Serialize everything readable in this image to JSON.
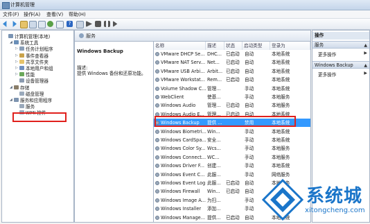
{
  "window": {
    "title": "计算机管理"
  },
  "menu": [
    "文件(F)",
    "操作(A)",
    "查看(V)",
    "帮助(H)"
  ],
  "tree": [
    {
      "label": "计算机管理(本地)",
      "level": 0,
      "exp": ""
    },
    {
      "label": "系统工具",
      "level": 1,
      "exp": "◢"
    },
    {
      "label": "任务计划程序",
      "level": 2,
      "exp": "▷"
    },
    {
      "label": "事件查看器",
      "level": 2,
      "exp": "▷"
    },
    {
      "label": "共享文件夹",
      "level": 2,
      "exp": "▷"
    },
    {
      "label": "本地用户和组",
      "level": 2,
      "exp": "▷"
    },
    {
      "label": "性能",
      "level": 2,
      "exp": "▷"
    },
    {
      "label": "设备管理器",
      "level": 2,
      "exp": ""
    },
    {
      "label": "存储",
      "level": 1,
      "exp": "◢"
    },
    {
      "label": "磁盘管理",
      "level": 2,
      "exp": ""
    },
    {
      "label": "服务和应用程序",
      "level": 1,
      "exp": "◢"
    },
    {
      "label": "服务",
      "level": 2,
      "exp": ""
    },
    {
      "label": "WMI 控件",
      "level": 2,
      "exp": ""
    }
  ],
  "services_header": "服务",
  "detail": {
    "name": "Windows Backup",
    "desc_label": "描述:",
    "desc_text": "提供 Windows 备份和还原功能。"
  },
  "columns": [
    "名称",
    "描述",
    "状态",
    "启动类型",
    "登录为"
  ],
  "rows": [
    [
      "VMware DHCP Se...",
      "DHC...",
      "已启动",
      "自动",
      "本地系统"
    ],
    [
      "VMware NAT Serv...",
      "Net...",
      "已启动",
      "自动",
      "本地系统"
    ],
    [
      "VMware USB Arbi...",
      "Arbit...",
      "已启动",
      "自动",
      "本地系统"
    ],
    [
      "VMware Workstat...",
      "Rem...",
      "已启动",
      "自动",
      "本地系统"
    ],
    [
      "Volume Shadow C...",
      "管理...",
      "",
      "手动",
      "本地系统"
    ],
    [
      "WebClient",
      "使基...",
      "",
      "手动",
      "本地服务"
    ],
    [
      "Windows Audio",
      "管理...",
      "已启动",
      "自动",
      "本地服务"
    ],
    [
      "Windows Audio E...",
      "管理...",
      "已启动",
      "自动",
      "本地系统"
    ],
    [
      "Windows Backup",
      "提供 ...",
      "",
      "禁用",
      "本地系统"
    ],
    [
      "Windows Biometri...",
      "Win...",
      "",
      "手动",
      "本地系统"
    ],
    [
      "Windows CardSpa...",
      "安全...",
      "",
      "手动",
      "本地系统"
    ],
    [
      "Windows Color Sy...",
      "Wcs...",
      "",
      "手动",
      "本地服务"
    ],
    [
      "Windows Connect...",
      "WC...",
      "",
      "手动",
      "本地服务"
    ],
    [
      "Windows Driver F...",
      "创建...",
      "",
      "手动",
      "本地系统"
    ],
    [
      "Windows Event C...",
      "此服...",
      "",
      "手动",
      "网络服务"
    ],
    [
      "Windows Event Log",
      "此服...",
      "已启动",
      "自动",
      "本地服务"
    ],
    [
      "Windows Firewall",
      "Win...",
      "已启动",
      "自动",
      "本地服务"
    ],
    [
      "Windows Image A...",
      "为扫...",
      "",
      "手动",
      "本地服务"
    ],
    [
      "Windows Installer",
      "添加...",
      "",
      "手动",
      "本地系统"
    ],
    [
      "Windows Manage...",
      "提供...",
      "已启动",
      "自动",
      "本地系统"
    ]
  ],
  "selected_row": 8,
  "actions": {
    "header": "操作",
    "sec1": "服务",
    "sec1_item": "更多操作",
    "sec2": "Windows Backup",
    "sec2_item": "更多操作"
  },
  "watermark": {
    "brand": "系统城",
    "url": "xitongcheng.com"
  },
  "colors": {
    "selection": "#3399ff",
    "highlight": "#e0201c",
    "accent": "#1a75c9"
  }
}
